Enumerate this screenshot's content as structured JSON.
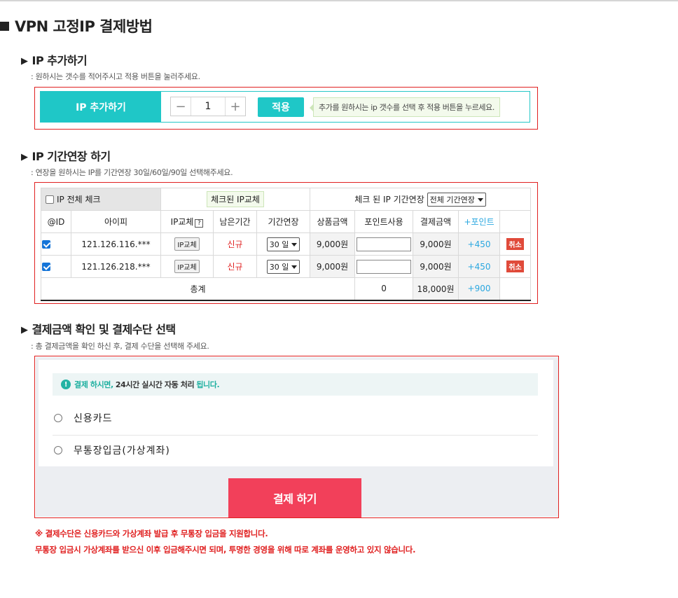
{
  "page_title": "VPN 고정IP 결제방법",
  "add_section": {
    "title": "IP 추가하기",
    "desc": ": 원하시는 갯수를 적어주시고 적용 버튼을 눌러주세요.",
    "label": "IP 추가하기",
    "minus": "−",
    "qty": "1",
    "plus": "+",
    "apply_label": "적용",
    "hint": "추가를 원하시는 ip 갯수를 선택 후 적용 버튼을 누르세요."
  },
  "extend_section": {
    "title": "IP 기간연장 하기",
    "desc": ": 연장을 원하시는 IP를 기간연장 30일/60일/90일 선택해주세요.",
    "check_all": "IP 전체 체크",
    "change_checked": "체크된 IP교체",
    "extend_checked_label": "체크 된 IP 기간연장",
    "extend_all_option": "전체 기간연장",
    "headers": [
      "@ID",
      "아이피",
      "IP교체",
      "남은기간",
      "기간연장",
      "상품금액",
      "포인트사용",
      "결제금액",
      "+포인트",
      ""
    ],
    "help_mark": "?",
    "rows": [
      {
        "ip": "121.126.116.***",
        "change": "IP교체",
        "remain": "신규",
        "period": "30 일",
        "price": "9,000원",
        "pay": "9,000원",
        "point": "+450",
        "cancel": "취소"
      },
      {
        "ip": "121.126.218.***",
        "change": "IP교체",
        "remain": "신규",
        "period": "30 일",
        "price": "9,000원",
        "pay": "9,000원",
        "point": "+450",
        "cancel": "취소"
      }
    ],
    "total": {
      "label": "총계",
      "price": "18,000원",
      "point_used": "0",
      "pay": "18,000원",
      "point": "+900"
    }
  },
  "payment_section": {
    "title": "결제금액 확인 및 결제수단 선택",
    "desc": ": 총 결제금액을 확인 하신 후, 결제 수단을 선택해 주세요.",
    "notice_icon": "!",
    "notice_part1": "결제 하시면,",
    "notice_part2": "24시간 실시간 자동 처리",
    "notice_part3": "됩니다.",
    "methods": [
      "신용카드",
      "무통장입금(가상계좌)"
    ],
    "pay_button": "결제 하기"
  },
  "footer_notes": [
    "※ 결제수단은 신용카드와 가상계좌 발급 후 무통장 입금을 지원합니다.",
    "무통장 입금시 가상계좌를 받으신 이후 입금해주시면 되며, 투명한 경영을 위해 따로 계좌를 운영하고 있지 않습니다."
  ],
  "colors": {
    "accent": "#1fc7c7",
    "border_red": "#e02020",
    "pay_button": "#f2405a",
    "point_blue": "#2aa7e0"
  }
}
